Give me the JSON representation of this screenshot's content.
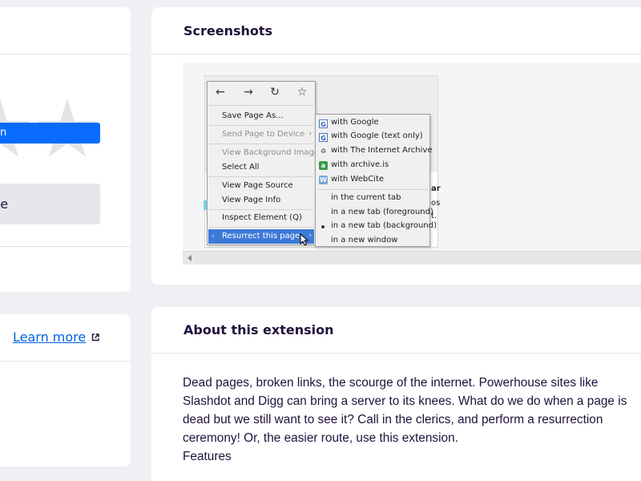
{
  "left_top_card": {
    "primary_button_label": "n",
    "secondary_button_label": "ouse"
  },
  "left_bottom_card": {
    "learn_more_label": "Learn more"
  },
  "screenshots": {
    "title": "Screenshots",
    "context_menu": {
      "nav_icons": [
        "back-icon",
        "forward-icon",
        "reload-icon",
        "bookmark-star-icon"
      ],
      "items": [
        {
          "label": "Save Page As...",
          "disabled": false
        },
        {
          "label": "Send Page to Device",
          "disabled": true,
          "submenu": true
        },
        {
          "label": "View Background Image",
          "disabled": true
        },
        {
          "label": "Select All",
          "disabled": false
        },
        {
          "label": "View Page Source",
          "disabled": false
        },
        {
          "label": "View Page Info",
          "disabled": false
        },
        {
          "label": "Inspect Element (Q)",
          "disabled": false
        },
        {
          "label": "Resurrect this page",
          "disabled": false,
          "submenu": true,
          "highlighted": true
        }
      ]
    },
    "submenu": {
      "items": [
        {
          "label": "with Google",
          "icon": "google-icon"
        },
        {
          "label": "with Google (text only)",
          "icon": "google-icon"
        },
        {
          "label": "with The Internet Archive",
          "icon": "archive-icon"
        },
        {
          "label": "with archive.is",
          "icon": "archive-is-icon"
        },
        {
          "label": "with WebCite",
          "icon": "webcite-icon"
        },
        {
          "label": "in the current tab"
        },
        {
          "label": "in a new tab (foreground)"
        },
        {
          "label": "in a new tab (background)",
          "selected": true
        },
        {
          "label": "in a new window"
        }
      ]
    },
    "partial_text": [
      "ar",
      "os",
      "t."
    ]
  },
  "about": {
    "title": "About this extension",
    "lines": [
      "Dead pages, broken links, the scourge of the internet. Powerhouse sites like",
      "Slashdot and Digg can bring a server to its knees. What do we do when a page is",
      "dead but we still want to see it? Call in the clerics, and perform a resurrection",
      "ceremony! Or, the easier route, use this extension.",
      "Features"
    ]
  },
  "colors": {
    "accent_blue": "#0a6cff",
    "link_blue": "#0060df",
    "menu_highlight": "#3d7ad8",
    "background": "#eef0f3"
  }
}
